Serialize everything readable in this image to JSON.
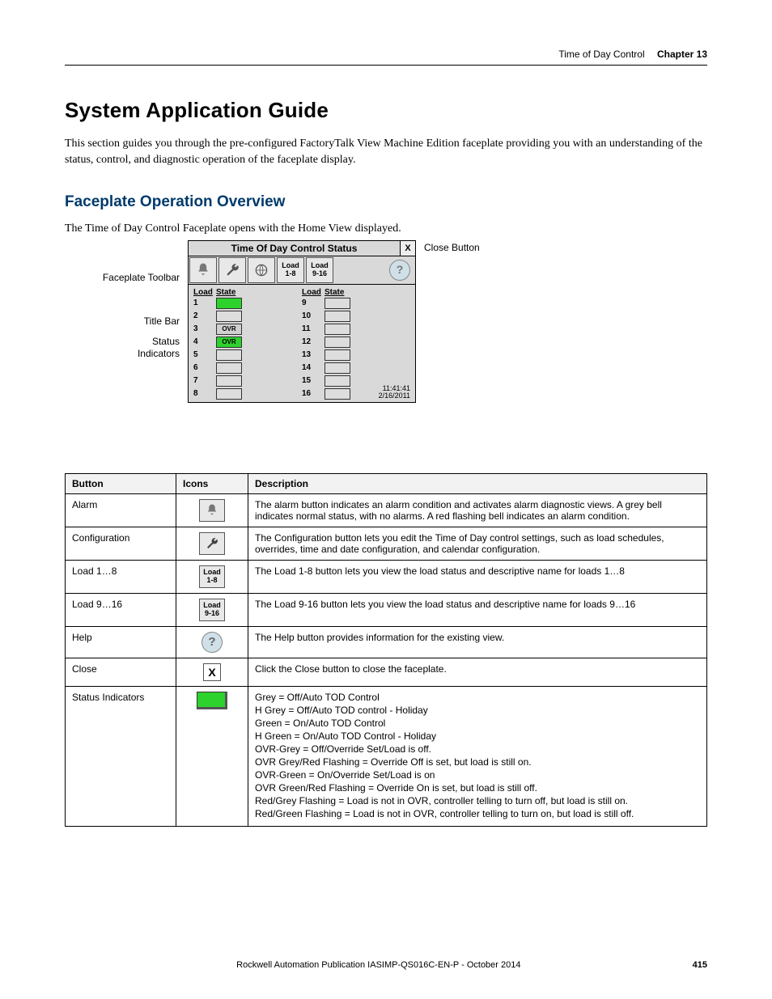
{
  "header": {
    "section": "Time of Day Control",
    "chapter": "Chapter 13"
  },
  "title": "System Application Guide",
  "intro": "This section guides you through the pre-configured FactoryTalk View Machine Edition faceplate providing you with an understanding of the status, control, and diagnostic operation of the faceplate display.",
  "subheading": "Faceplate Operation Overview",
  "caption": "The Time of Day Control Faceplate opens with the Home View displayed.",
  "diagram": {
    "labels": {
      "title_bar": "Title Bar",
      "faceplate_toolbar": "Faceplate Toolbar",
      "status_indicators": "Status\nIndicators",
      "close_button": "Close Button"
    },
    "faceplate": {
      "title": "Time Of Day Control Status",
      "close": "X",
      "toolbar": {
        "load18": "Load\n1-8",
        "load916": "Load\n9-16"
      },
      "col_headers": {
        "load": "Load",
        "state": "State"
      },
      "left_rows": [
        {
          "n": "1",
          "state": "",
          "cls": "on"
        },
        {
          "n": "2",
          "state": "",
          "cls": ""
        },
        {
          "n": "3",
          "state": "OVR",
          "cls": "ovr-off"
        },
        {
          "n": "4",
          "state": "OVR",
          "cls": "ovr-on"
        },
        {
          "n": "5",
          "state": "",
          "cls": ""
        },
        {
          "n": "6",
          "state": "",
          "cls": ""
        },
        {
          "n": "7",
          "state": "",
          "cls": ""
        },
        {
          "n": "8",
          "state": "",
          "cls": ""
        }
      ],
      "right_rows": [
        {
          "n": "9",
          "state": "",
          "cls": ""
        },
        {
          "n": "10",
          "state": "",
          "cls": ""
        },
        {
          "n": "11",
          "state": "",
          "cls": ""
        },
        {
          "n": "12",
          "state": "",
          "cls": ""
        },
        {
          "n": "13",
          "state": "",
          "cls": ""
        },
        {
          "n": "14",
          "state": "",
          "cls": ""
        },
        {
          "n": "15",
          "state": "",
          "cls": ""
        },
        {
          "n": "16",
          "state": "",
          "cls": ""
        }
      ],
      "time": "11:41:41",
      "date": "2/16/2011"
    }
  },
  "table": {
    "headers": {
      "button": "Button",
      "icons": "Icons",
      "description": "Description"
    },
    "rows": [
      {
        "button": "Alarm",
        "icon_type": "bell",
        "desc": "The alarm button indicates an alarm condition and activates alarm diagnostic views. A grey bell indicates normal status, with no alarms. A red flashing bell indicates an alarm condition."
      },
      {
        "button": "Configuration",
        "icon_type": "config",
        "desc": "The Configuration button lets you edit the Time of Day control settings, such as load schedules, overrides, time and date configuration, and calendar configuration."
      },
      {
        "button": "Load 1…8",
        "icon_type": "load18",
        "icon_label": "Load\n1-8",
        "desc": "The Load 1-8 button lets you view the load status and descriptive name for loads 1…8"
      },
      {
        "button": "Load 9…16",
        "icon_type": "load916",
        "icon_label": "Load\n9-16",
        "desc": "The Load 9-16 button lets you view the load status and descriptive name for loads 9…16"
      },
      {
        "button": "Help",
        "icon_type": "help",
        "desc": "The Help button provides information for the existing view."
      },
      {
        "button": "Close",
        "icon_type": "close",
        "desc": "Click the Close button to close the faceplate."
      },
      {
        "button": "Status Indicators",
        "icon_type": "status",
        "lines": [
          "Grey = Off/Auto TOD Control",
          "H Grey = Off/Auto TOD control - Holiday",
          "Green = On/Auto TOD Control",
          "H Green = On/Auto TOD Control - Holiday",
          "OVR-Grey = Off/Override Set/Load is off.",
          "OVR Grey/Red Flashing = Override Off is set, but load is still on.",
          "OVR-Green = On/Override Set/Load is on",
          "OVR Green/Red Flashing = Override On is set, but load is still off.",
          "Red/Grey Flashing = Load is not in OVR, controller telling to turn off, but load is still on.",
          "Red/Green Flashing = Load is not in OVR, controller telling to turn on, but load is still off."
        ]
      }
    ]
  },
  "footer": {
    "pub": "Rockwell Automation Publication IASIMP-QS016C-EN-P - October 2014",
    "page": "415"
  }
}
